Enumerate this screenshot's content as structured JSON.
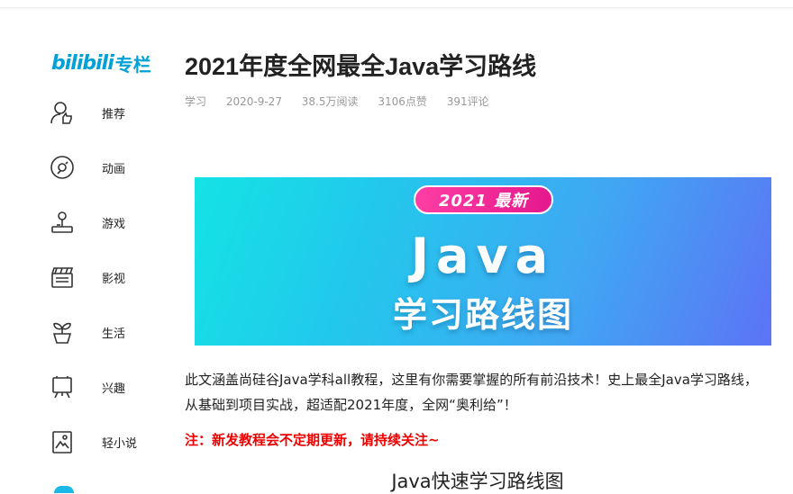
{
  "logo": {
    "brand": "bilibili",
    "suffix": "专栏"
  },
  "sidebar": {
    "items": [
      {
        "label": "推荐",
        "icon": "recommend-user-icon"
      },
      {
        "label": "动画",
        "icon": "disc-icon"
      },
      {
        "label": "游戏",
        "icon": "joystick-icon"
      },
      {
        "label": "影视",
        "icon": "clapperboard-icon"
      },
      {
        "label": "生活",
        "icon": "plant-pot-icon"
      },
      {
        "label": "兴趣",
        "icon": "easel-icon"
      },
      {
        "label": "轻小说",
        "icon": "book-image-icon"
      }
    ]
  },
  "article": {
    "title": "2021年度全网最全Java学习路线",
    "meta": {
      "category": "学习",
      "date": "2020-9-27",
      "views": "38.5万阅读",
      "likes": "3106点赞",
      "comments": "391评论"
    },
    "banner": {
      "badge": "2021 最新",
      "headline": "Java",
      "subline": "学习路线图"
    },
    "paragraph": "此文涵盖尚硅谷Java学科all教程，这里有你需要掌握的所有前沿技术！史上最全Java学习路线，从基础到项目实战，超适配2021年度，全网“奥利给”！",
    "note": "注：新发教程会不定期更新，请持续关注~",
    "subheading": "Java快速学习路线图"
  },
  "colors": {
    "brand": "#00a1d6",
    "note": "#e00000",
    "banner_start": "#14e3e4",
    "banner_end": "#5d73f5",
    "badge": "#e5188d"
  }
}
